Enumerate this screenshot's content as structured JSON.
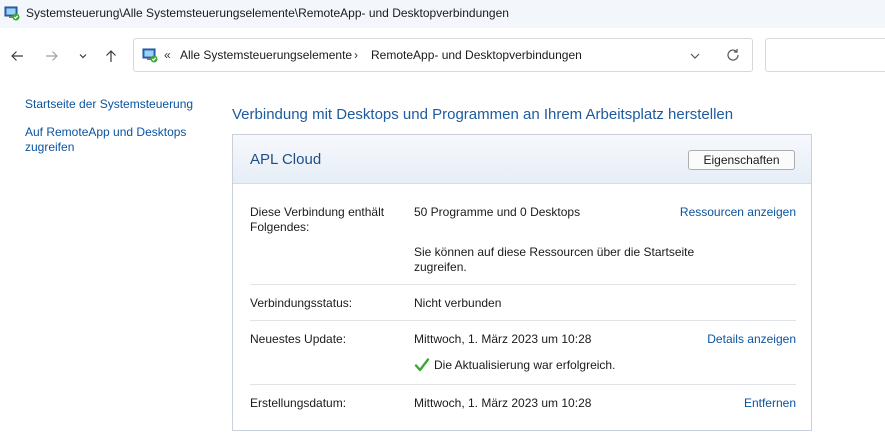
{
  "window": {
    "title": "Systemsteuerung\\Alle Systemsteuerungselemente\\RemoteApp- und Desktopverbindungen",
    "app_icon": "remoteapp-icon"
  },
  "address_bar": {
    "crumb_start": "«",
    "crumbs": [
      "Alle Systemsteuerungselemente",
      "RemoteApp- und Desktopverbindungen"
    ],
    "separator": "›"
  },
  "sidebar": {
    "links": [
      {
        "label": "Startseite der Systemsteuerung"
      },
      {
        "label": "Auf RemoteApp und Desktops zugreifen"
      }
    ]
  },
  "main": {
    "heading": "Verbindung mit Desktops und Programmen an Ihrem Arbeitsplatz herstellen",
    "connection": {
      "name": "APL Cloud",
      "properties_button": "Eigenschaften",
      "rows": {
        "contents": {
          "label": "Diese Verbindung enthält Folgendes:",
          "value": "50 Programme und 0 Desktops",
          "note": "Sie können auf diese Ressourcen über die Startseite zugreifen.",
          "link": "Ressourcen anzeigen"
        },
        "status": {
          "label": "Verbindungsstatus:",
          "value": "Nicht verbunden"
        },
        "update": {
          "label": "Neuestes Update:",
          "value": "Mittwoch, 1. März 2023 um 10:28",
          "link": "Details anzeigen",
          "result": "Die Aktualisierung war erfolgreich."
        },
        "created": {
          "label": "Erstellungsdatum:",
          "value": "Mittwoch, 1. März 2023 um 10:28",
          "link": "Entfernen"
        }
      }
    }
  },
  "colors": {
    "link": "#0b53a0",
    "heading": "#1e5a9e",
    "success_check": "#3aa935"
  }
}
